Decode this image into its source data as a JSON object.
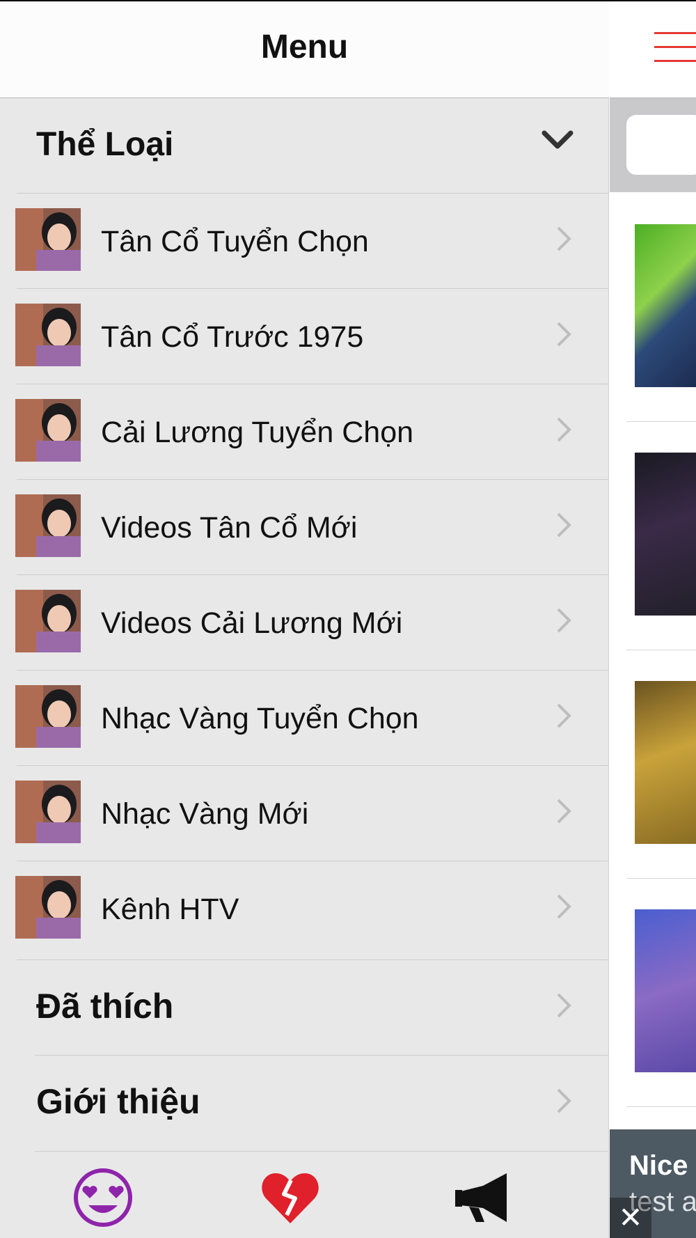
{
  "menu": {
    "title": "Menu",
    "section_title": "Thể Loại",
    "categories": [
      {
        "label": "Tân Cổ Tuyển Chọn"
      },
      {
        "label": "Tân Cổ Trước 1975"
      },
      {
        "label": "Cải Lương Tuyển Chọn"
      },
      {
        "label": "Videos Tân Cổ Mới"
      },
      {
        "label": "Videos Cải Lương Mới"
      },
      {
        "label": "Nhạc Vàng Tuyển Chọn"
      },
      {
        "label": "Nhạc Vàng Mới"
      },
      {
        "label": "Kênh HTV"
      }
    ],
    "liked_label": "Đã thích",
    "about_label": "Giới thiệu"
  },
  "tabbar": {
    "icons": [
      "heart-eyes-emoji-icon",
      "broken-heart-icon",
      "megaphone-icon"
    ],
    "colors": {
      "heart_eyes": "#8e24aa",
      "broken_heart": "#e0202a",
      "megaphone": "#111111"
    }
  },
  "ad": {
    "title": "Nice",
    "subtitle": "test a",
    "close_glyph": "✕"
  },
  "colors": {
    "accent": "#e53935",
    "drawer_bg": "#e8e8e8"
  }
}
